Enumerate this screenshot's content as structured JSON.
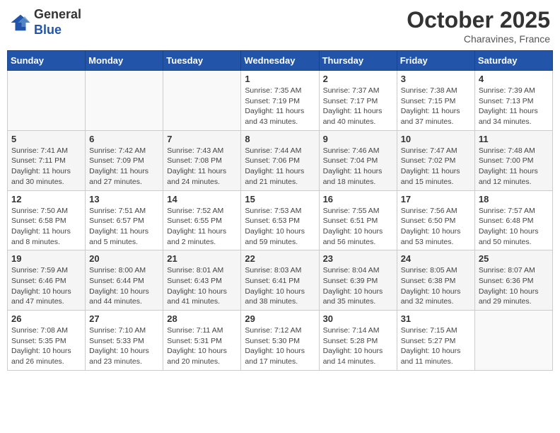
{
  "header": {
    "logo_line1": "General",
    "logo_line2": "Blue",
    "month": "October 2025",
    "location": "Charavines, France"
  },
  "days_of_week": [
    "Sunday",
    "Monday",
    "Tuesday",
    "Wednesday",
    "Thursday",
    "Friday",
    "Saturday"
  ],
  "weeks": [
    [
      {
        "day": "",
        "info": ""
      },
      {
        "day": "",
        "info": ""
      },
      {
        "day": "",
        "info": ""
      },
      {
        "day": "1",
        "info": "Sunrise: 7:35 AM\nSunset: 7:19 PM\nDaylight: 11 hours\nand 43 minutes."
      },
      {
        "day": "2",
        "info": "Sunrise: 7:37 AM\nSunset: 7:17 PM\nDaylight: 11 hours\nand 40 minutes."
      },
      {
        "day": "3",
        "info": "Sunrise: 7:38 AM\nSunset: 7:15 PM\nDaylight: 11 hours\nand 37 minutes."
      },
      {
        "day": "4",
        "info": "Sunrise: 7:39 AM\nSunset: 7:13 PM\nDaylight: 11 hours\nand 34 minutes."
      }
    ],
    [
      {
        "day": "5",
        "info": "Sunrise: 7:41 AM\nSunset: 7:11 PM\nDaylight: 11 hours\nand 30 minutes."
      },
      {
        "day": "6",
        "info": "Sunrise: 7:42 AM\nSunset: 7:09 PM\nDaylight: 11 hours\nand 27 minutes."
      },
      {
        "day": "7",
        "info": "Sunrise: 7:43 AM\nSunset: 7:08 PM\nDaylight: 11 hours\nand 24 minutes."
      },
      {
        "day": "8",
        "info": "Sunrise: 7:44 AM\nSunset: 7:06 PM\nDaylight: 11 hours\nand 21 minutes."
      },
      {
        "day": "9",
        "info": "Sunrise: 7:46 AM\nSunset: 7:04 PM\nDaylight: 11 hours\nand 18 minutes."
      },
      {
        "day": "10",
        "info": "Sunrise: 7:47 AM\nSunset: 7:02 PM\nDaylight: 11 hours\nand 15 minutes."
      },
      {
        "day": "11",
        "info": "Sunrise: 7:48 AM\nSunset: 7:00 PM\nDaylight: 11 hours\nand 12 minutes."
      }
    ],
    [
      {
        "day": "12",
        "info": "Sunrise: 7:50 AM\nSunset: 6:58 PM\nDaylight: 11 hours\nand 8 minutes."
      },
      {
        "day": "13",
        "info": "Sunrise: 7:51 AM\nSunset: 6:57 PM\nDaylight: 11 hours\nand 5 minutes."
      },
      {
        "day": "14",
        "info": "Sunrise: 7:52 AM\nSunset: 6:55 PM\nDaylight: 11 hours\nand 2 minutes."
      },
      {
        "day": "15",
        "info": "Sunrise: 7:53 AM\nSunset: 6:53 PM\nDaylight: 10 hours\nand 59 minutes."
      },
      {
        "day": "16",
        "info": "Sunrise: 7:55 AM\nSunset: 6:51 PM\nDaylight: 10 hours\nand 56 minutes."
      },
      {
        "day": "17",
        "info": "Sunrise: 7:56 AM\nSunset: 6:50 PM\nDaylight: 10 hours\nand 53 minutes."
      },
      {
        "day": "18",
        "info": "Sunrise: 7:57 AM\nSunset: 6:48 PM\nDaylight: 10 hours\nand 50 minutes."
      }
    ],
    [
      {
        "day": "19",
        "info": "Sunrise: 7:59 AM\nSunset: 6:46 PM\nDaylight: 10 hours\nand 47 minutes."
      },
      {
        "day": "20",
        "info": "Sunrise: 8:00 AM\nSunset: 6:44 PM\nDaylight: 10 hours\nand 44 minutes."
      },
      {
        "day": "21",
        "info": "Sunrise: 8:01 AM\nSunset: 6:43 PM\nDaylight: 10 hours\nand 41 minutes."
      },
      {
        "day": "22",
        "info": "Sunrise: 8:03 AM\nSunset: 6:41 PM\nDaylight: 10 hours\nand 38 minutes."
      },
      {
        "day": "23",
        "info": "Sunrise: 8:04 AM\nSunset: 6:39 PM\nDaylight: 10 hours\nand 35 minutes."
      },
      {
        "day": "24",
        "info": "Sunrise: 8:05 AM\nSunset: 6:38 PM\nDaylight: 10 hours\nand 32 minutes."
      },
      {
        "day": "25",
        "info": "Sunrise: 8:07 AM\nSunset: 6:36 PM\nDaylight: 10 hours\nand 29 minutes."
      }
    ],
    [
      {
        "day": "26",
        "info": "Sunrise: 7:08 AM\nSunset: 5:35 PM\nDaylight: 10 hours\nand 26 minutes."
      },
      {
        "day": "27",
        "info": "Sunrise: 7:10 AM\nSunset: 5:33 PM\nDaylight: 10 hours\nand 23 minutes."
      },
      {
        "day": "28",
        "info": "Sunrise: 7:11 AM\nSunset: 5:31 PM\nDaylight: 10 hours\nand 20 minutes."
      },
      {
        "day": "29",
        "info": "Sunrise: 7:12 AM\nSunset: 5:30 PM\nDaylight: 10 hours\nand 17 minutes."
      },
      {
        "day": "30",
        "info": "Sunrise: 7:14 AM\nSunset: 5:28 PM\nDaylight: 10 hours\nand 14 minutes."
      },
      {
        "day": "31",
        "info": "Sunrise: 7:15 AM\nSunset: 5:27 PM\nDaylight: 10 hours\nand 11 minutes."
      },
      {
        "day": "",
        "info": ""
      }
    ]
  ]
}
